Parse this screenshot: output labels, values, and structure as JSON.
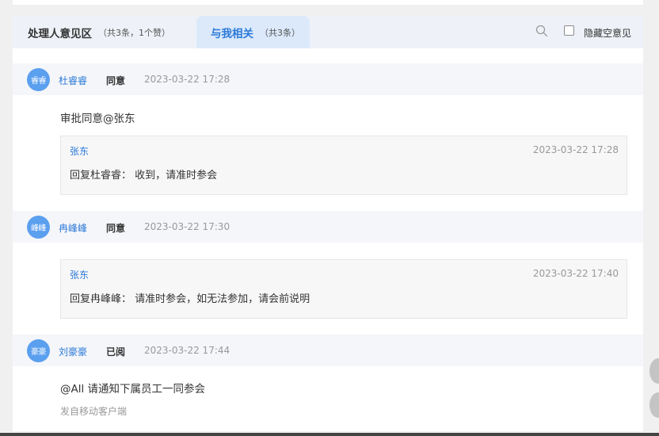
{
  "tabs": {
    "opinions": {
      "label": "处理人意见区",
      "count": "（共3条，1个赞）"
    },
    "related": {
      "label": "与我相关",
      "count": "（共3条）"
    }
  },
  "toolbar": {
    "hide_empty_label": "隐藏空意见"
  },
  "comments": [
    {
      "avatar": "睿睿",
      "user": "杜睿睿",
      "action": "同意",
      "time": "2023-03-22 17:28",
      "text": "审批同意@张东",
      "reply": {
        "user": "张东",
        "time": "2023-03-22 17:28",
        "text": "回复杜睿睿： 收到，请准时参会"
      }
    },
    {
      "avatar": "峰峰",
      "user": "冉峰峰",
      "action": "同意",
      "time": "2023-03-22 17:30",
      "reply": {
        "user": "张东",
        "time": "2023-03-22 17:40",
        "text": "回复冉峰峰： 请准时参会，如无法参加，请会前说明"
      }
    },
    {
      "avatar": "豪豪",
      "user": "刘豪豪",
      "action": "已阅",
      "time": "2023-03-22 17:44",
      "text": "@All 请通知下属员工一同参会",
      "source": "发自移动客户端"
    }
  ],
  "colors": {
    "accent": "#2b79d8",
    "avatar": "#5b9fef",
    "tab_active_bg": "#dbe9fb"
  }
}
